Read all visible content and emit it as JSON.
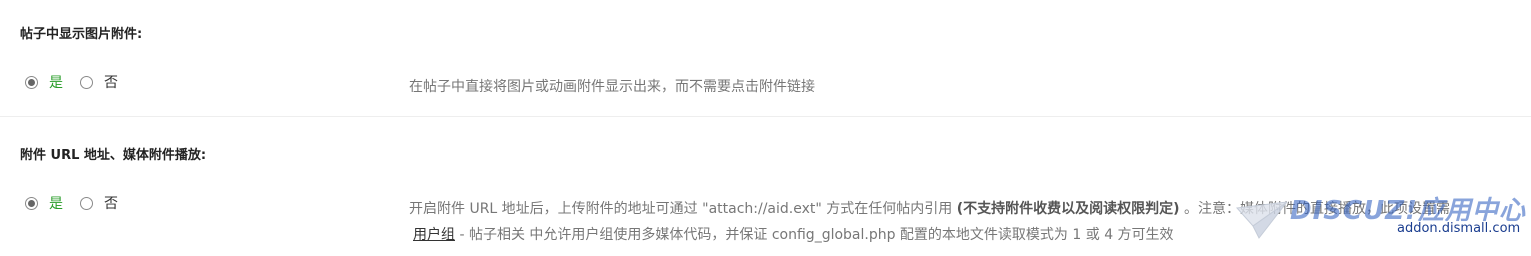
{
  "settings": [
    {
      "title": "帖子中显示图片附件:",
      "option_yes": "是",
      "option_no": "否",
      "selected": "yes",
      "description": "在帖子中直接将图片或动画附件显示出来，而不需要点击附件链接"
    },
    {
      "title": "附件 URL 地址、媒体附件播放:",
      "option_yes": "是",
      "option_no": "否",
      "selected": "yes",
      "description_line1_a": "开启附件 URL 地址后，上传附件的地址可通过 \"attach://aid.ext\" 方式在任何帖内引用",
      "description_line1_bold": "(不支持附件收费以及阅读权限判定)",
      "description_line1_b": " 。注意：媒体附件的直接播放，此项设置需",
      "description_link": "用户组",
      "description_line2": " - 帖子相关 中允许用户组使用多媒体代码，并保证 config_global.php 配置的本地文件读取模式为 1 或 4 方可生效"
    }
  ],
  "watermark": {
    "logo_text": "DISCUZ!应用中心",
    "url_text": "addon.dismall.com"
  },
  "colors": {
    "selected_label": "#2a9d2a",
    "description": "#777777",
    "divider": "#eeeeee"
  }
}
